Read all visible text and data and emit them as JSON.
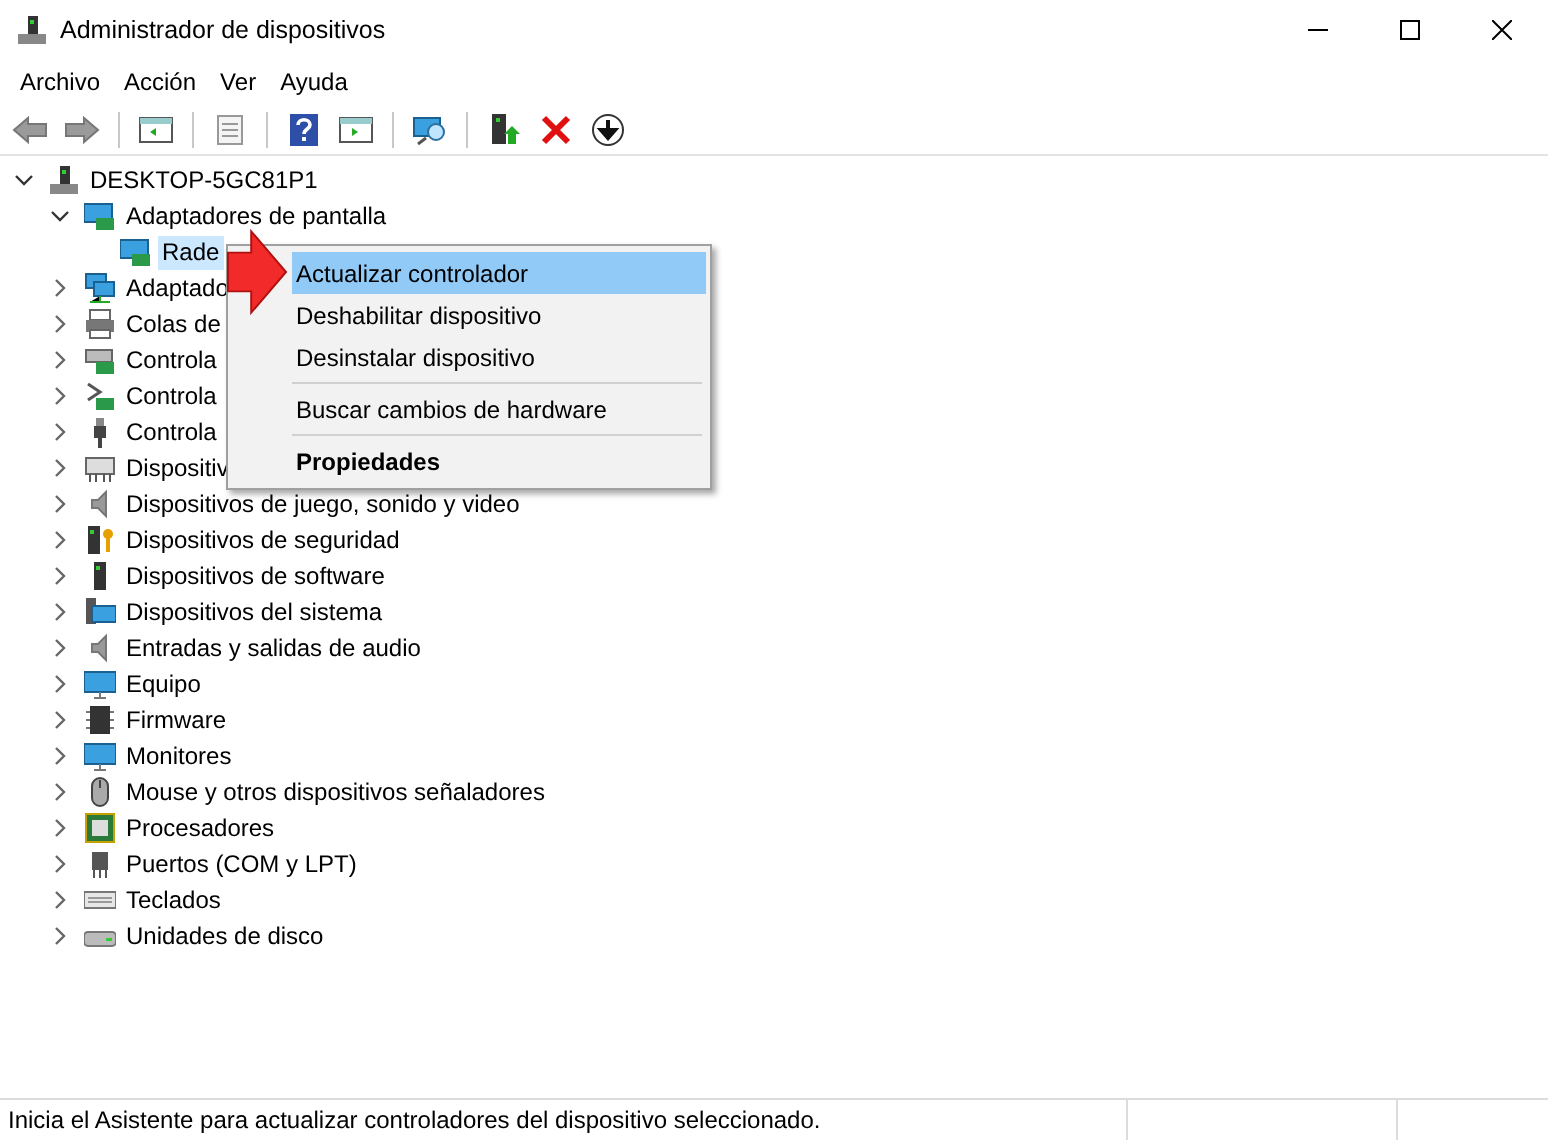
{
  "window": {
    "title": "Administrador de dispositivos"
  },
  "menu": [
    "Archivo",
    "Acción",
    "Ver",
    "Ayuda"
  ],
  "tree": {
    "label": "DESKTOP-5GC81P1",
    "expanded": true,
    "selected": false,
    "children": [
      {
        "label": "Adaptadores de pantalla",
        "expanded": true,
        "selected": false,
        "children": [
          {
            "label": "Rade",
            "selected": true
          }
        ]
      },
      {
        "label": "Adaptado",
        "expanded": false,
        "selected": false
      },
      {
        "label": "Colas de",
        "expanded": false,
        "selected": false
      },
      {
        "label": "Controla",
        "expanded": false,
        "selected": false
      },
      {
        "label": "Controla",
        "expanded": false,
        "selected": false
      },
      {
        "label": "Controla",
        "expanded": false,
        "selected": false
      },
      {
        "label": "Dispositiv",
        "expanded": false,
        "selected": false
      },
      {
        "label": "Dispositivos de juego, sonido y video",
        "expanded": false,
        "selected": false
      },
      {
        "label": "Dispositivos de seguridad",
        "expanded": false,
        "selected": false
      },
      {
        "label": "Dispositivos de software",
        "expanded": false,
        "selected": false
      },
      {
        "label": "Dispositivos del sistema",
        "expanded": false,
        "selected": false
      },
      {
        "label": "Entradas y salidas de audio",
        "expanded": false,
        "selected": false
      },
      {
        "label": "Equipo",
        "expanded": false,
        "selected": false
      },
      {
        "label": "Firmware",
        "expanded": false,
        "selected": false
      },
      {
        "label": "Monitores",
        "expanded": false,
        "selected": false
      },
      {
        "label": "Mouse y otros dispositivos señaladores",
        "expanded": false,
        "selected": false
      },
      {
        "label": "Procesadores",
        "expanded": false,
        "selected": false
      },
      {
        "label": "Puertos (COM y LPT)",
        "expanded": false,
        "selected": false
      },
      {
        "label": "Teclados",
        "expanded": false,
        "selected": false
      },
      {
        "label": "Unidades de disco",
        "expanded": false,
        "selected": false
      }
    ]
  },
  "context_menu": {
    "items": [
      {
        "kind": "item",
        "label": "Actualizar controlador",
        "selected": true,
        "default": false
      },
      {
        "kind": "item",
        "label": "Deshabilitar dispositivo",
        "selected": false,
        "default": false
      },
      {
        "kind": "item",
        "label": "Desinstalar dispositivo",
        "selected": false,
        "default": false
      },
      {
        "kind": "separator"
      },
      {
        "kind": "item",
        "label": "Buscar cambios de hardware",
        "selected": false,
        "default": false
      },
      {
        "kind": "separator"
      },
      {
        "kind": "item",
        "label": "Propiedades",
        "selected": false,
        "default": true
      }
    ]
  },
  "status_bar": {
    "text": "Inicia el Asistente para actualizar controladores del dispositivo seleccionado."
  }
}
